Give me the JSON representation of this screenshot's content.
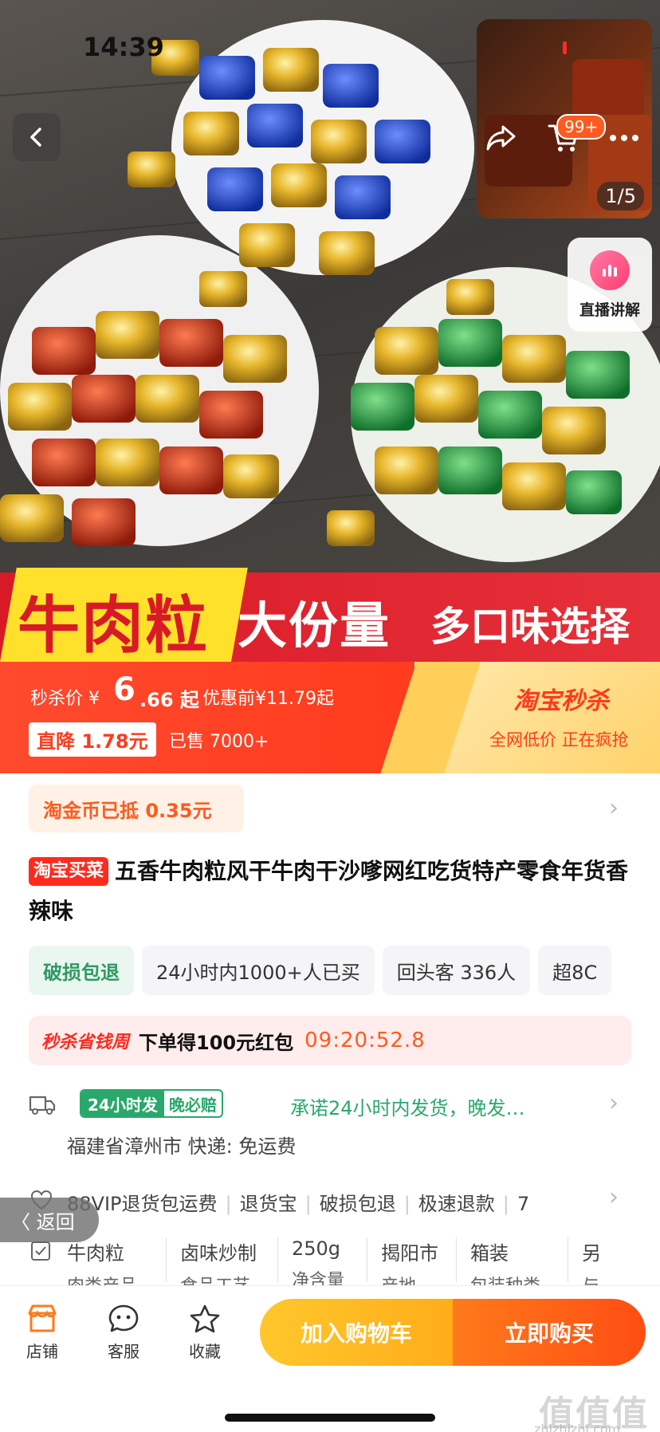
{
  "status_bar": {
    "time": "14:39"
  },
  "gallery": {
    "counter": "1/5",
    "cart_badge": "99+",
    "live_label": "直播讲解"
  },
  "banner": {
    "t1": "牛肉粒",
    "t2": "大份量",
    "t3": "多口味选择"
  },
  "price": {
    "flash_label": "秒杀价 ¥",
    "int": "6",
    "dec": ".66 起",
    "before": "优惠前¥11.79起",
    "drop": "直降 1.78元",
    "sold": "已售 7000+",
    "tb_flash": "淘宝秒杀",
    "tb_sub": "全网低价 正在疯抢"
  },
  "coin": {
    "text": "淘金币已抵 0.35元"
  },
  "title": {
    "tag": "淘宝买菜",
    "text": "五香牛肉粒风干牛肉干沙嗲网红吃货特产零食年货香辣味"
  },
  "chips": [
    "破损包退",
    "24小时内1000+人已买",
    "回头客 336人",
    "超8C"
  ],
  "promo": {
    "logo": "秒杀省钱周",
    "text": "下单得100元红包",
    "time": "09:20:52.8"
  },
  "shipping": {
    "badge1": "24小时发",
    "badge2": "晚必赔",
    "promise": "承诺24小时内发货，晚发…",
    "origin": "福建省漳州市  快递: 免运费"
  },
  "services": [
    "88VIP退货包运费",
    "退货宝",
    "破损包退",
    "极速退款",
    "7"
  ],
  "return_label": "〈 返回",
  "params": [
    {
      "value": "牛肉粒",
      "sub": "肉类产品"
    },
    {
      "value": "卤味炒制",
      "sub": "食品工艺"
    },
    {
      "value": "250g",
      "sub": "净含量"
    },
    {
      "value": "揭阳市",
      "sub": "产地"
    },
    {
      "value": "箱装",
      "sub": "包装种类"
    },
    {
      "value": "另",
      "sub": "与"
    }
  ],
  "bottom": {
    "store": "店铺",
    "service": "客服",
    "favorite": "收藏",
    "add_cart": "加入购物车",
    "buy_now": "立即购买"
  },
  "watermark": {
    "main": "值值值",
    "sub": "zhizhizhi.com"
  },
  "colors": {
    "accent": "#ff4a2e",
    "green": "#2aa86b",
    "gold": "#f2c230"
  }
}
